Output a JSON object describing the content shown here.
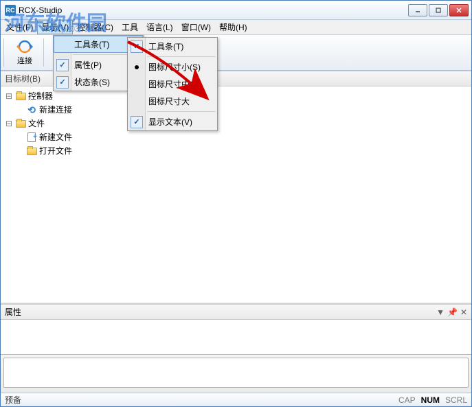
{
  "window": {
    "title": "RCX-Studio",
    "app_icon_text": "RC"
  },
  "menu_bar": {
    "items": [
      {
        "label": "文件(F)"
      },
      {
        "label": "显示(V)"
      },
      {
        "label": "控制器(C)"
      },
      {
        "label": "工具"
      },
      {
        "label": "语言(L)"
      },
      {
        "label": "窗口(W)"
      },
      {
        "label": "帮助(H)"
      }
    ]
  },
  "toolbar": {
    "connect_label": "连接"
  },
  "tree": {
    "header": "目标树(B)",
    "nodes": {
      "controller": "控制器",
      "new_conn": "新建连接",
      "file": "文件",
      "new_file": "新建文件",
      "open_file": "打开文件"
    }
  },
  "dropdown": {
    "menu1": {
      "toolbar": "工具条(T)",
      "properties": "属性(P)",
      "statusbar": "状态条(S)"
    },
    "menu2": {
      "toolbar": "工具条(T)",
      "icon_small": "图标尺寸小(S)",
      "icon_medium": "图标尺寸中(M)",
      "icon_large": "图标尺寸大",
      "show_text": "显示文本(V)"
    }
  },
  "props": {
    "header": "属性"
  },
  "status": {
    "left": "预备",
    "cap": "CAP",
    "num": "NUM",
    "scrl": "SCRL"
  },
  "watermark": {
    "text": "河东软件园",
    "url": "www.pc0359.cn"
  }
}
